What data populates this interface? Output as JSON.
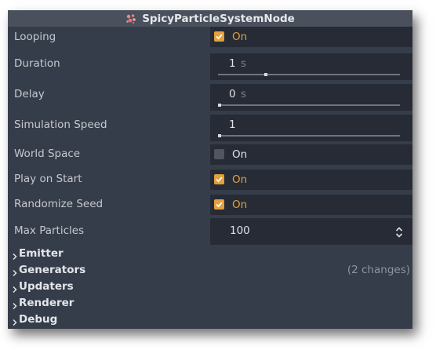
{
  "title": "SpicyParticleSystemNode",
  "title_icon": "particles-icon",
  "colors": {
    "panel_bg": "#363d4a",
    "field_bg": "#262b35",
    "accent": "#e3a03b",
    "label": "#c5c8ce"
  },
  "properties": {
    "looping": {
      "label": "Looping",
      "checked": true,
      "value": "On"
    },
    "duration": {
      "label": "Duration",
      "value": "1",
      "unit": "s",
      "slider_fraction": 0.26
    },
    "delay": {
      "label": "Delay",
      "value": "0",
      "unit": "s",
      "slider_fraction": 0.0
    },
    "simulation_speed": {
      "label": "Simulation Speed",
      "value": "1",
      "slider_fraction": 0.0
    },
    "world_space": {
      "label": "World Space",
      "checked": false,
      "value": "On"
    },
    "play_on_start": {
      "label": "Play on Start",
      "checked": true,
      "value": "On"
    },
    "randomize_seed": {
      "label": "Randomize Seed",
      "checked": true,
      "value": "On"
    },
    "max_particles": {
      "label": "Max Particles",
      "value": "100"
    }
  },
  "sections": {
    "emitter": {
      "label": "Emitter"
    },
    "generators": {
      "label": "Generators",
      "changes": "(2 changes)"
    },
    "updaters": {
      "label": "Updaters"
    },
    "renderer": {
      "label": "Renderer"
    },
    "debug": {
      "label": "Debug"
    }
  }
}
